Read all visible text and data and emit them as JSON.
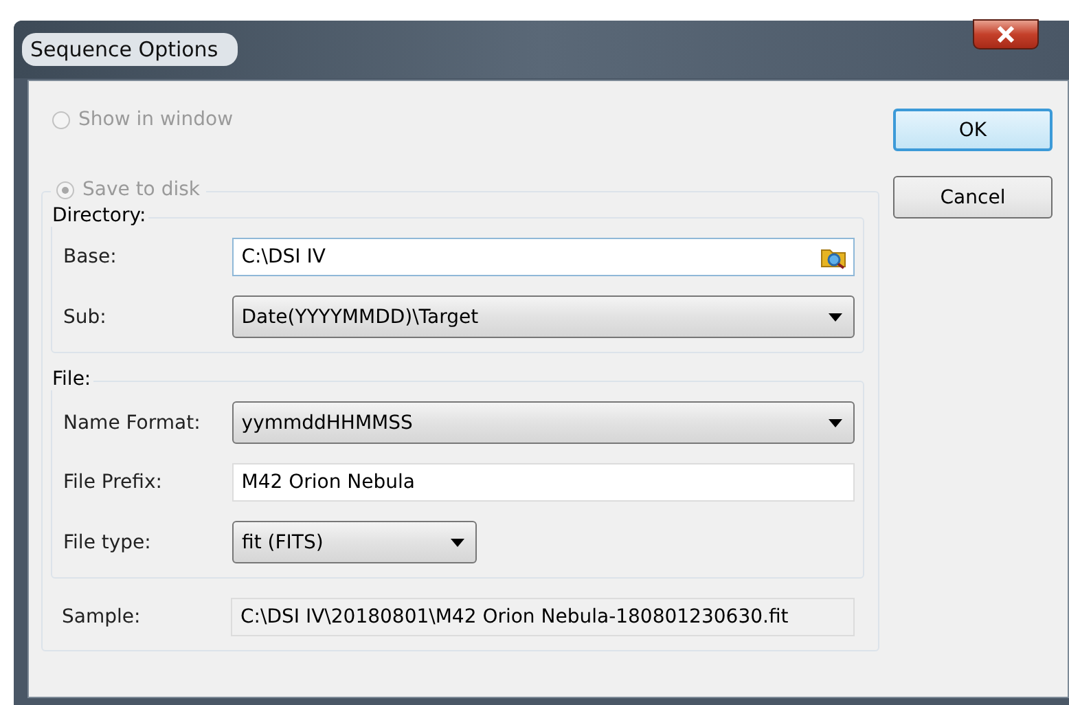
{
  "window": {
    "title": "Sequence Options"
  },
  "radios": [
    {
      "label": "Show in window",
      "selected": false,
      "disabled": true
    },
    {
      "label": "Save to disk",
      "selected": true,
      "disabled": true
    }
  ],
  "directory": {
    "title": "Directory:",
    "rows": [
      {
        "kind": "browse",
        "label": "Base:",
        "value": "C:\\DSI IV"
      },
      {
        "kind": "dropdown",
        "label": "Sub:",
        "value": "Date(YYYYMMDD)\\Target"
      }
    ]
  },
  "file": {
    "title": "File:",
    "rows": [
      {
        "kind": "dropdown",
        "label": "Name Format:",
        "value": "yymmddHHMMSS"
      },
      {
        "kind": "text",
        "label": "File Prefix:",
        "value": "M42 Orion Nebula"
      },
      {
        "kind": "short-dropdown",
        "label": "File type:",
        "value": "fit (FITS)"
      }
    ]
  },
  "sample": {
    "label": "Sample:",
    "value": "C:\\DSI IV\\20180801\\M42 Orion Nebula-180801230630.fit"
  },
  "buttons": [
    {
      "label": "OK",
      "default": true
    },
    {
      "label": "Cancel",
      "default": false
    }
  ]
}
